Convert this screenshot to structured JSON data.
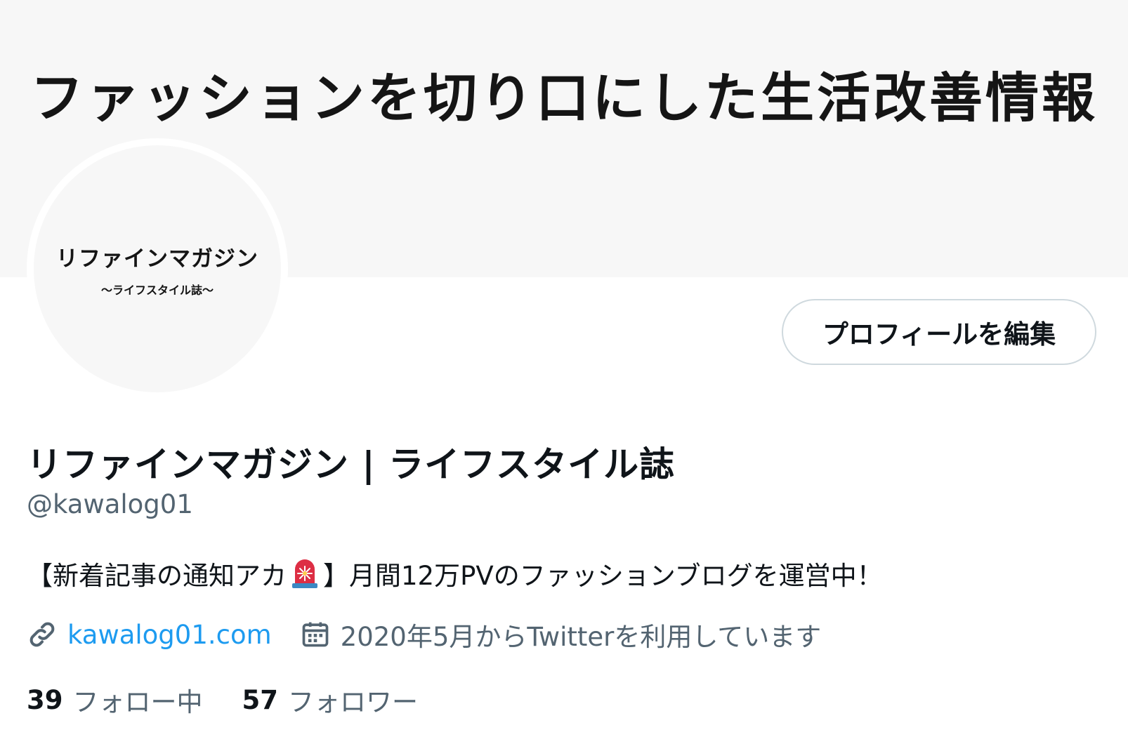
{
  "banner": {
    "text": "ファッションを切り口にした生活改善情報"
  },
  "avatar": {
    "title": "リファインマガジン",
    "subtitle": "〜ライフスタイル誌〜"
  },
  "profile": {
    "edit_button_label": "プロフィールを編集",
    "display_name": "リファインマガジン | ライフスタイル誌",
    "handle": "@kawalog01",
    "bio_before": "【新着記事の通知アカ",
    "bio_emoji": "siren-icon",
    "bio_after": "】月間12万PVのファッションブログを運営中！",
    "website": "kawalog01.com",
    "joined": "2020年5月からTwitterを利用しています"
  },
  "stats": {
    "following_count": "39",
    "following_label": "フォロー中",
    "followers_count": "57",
    "followers_label": "フォロワー"
  },
  "colors": {
    "link": "#1d9bf0",
    "secondary_text": "#536471",
    "banner_bg": "#f7f7f7"
  }
}
